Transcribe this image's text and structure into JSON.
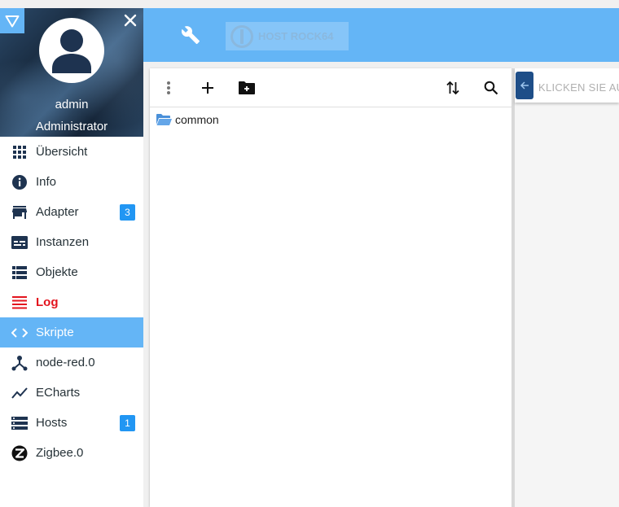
{
  "user": {
    "name": "admin",
    "role": "Administrator"
  },
  "sidebar": {
    "items": [
      {
        "label": "Übersicht",
        "icon": "grid-icon"
      },
      {
        "label": "Info",
        "icon": "info-icon"
      },
      {
        "label": "Adapter",
        "icon": "store-icon",
        "badge": "3"
      },
      {
        "label": "Instanzen",
        "icon": "instances-icon"
      },
      {
        "label": "Objekte",
        "icon": "list-icon"
      },
      {
        "label": "Log",
        "icon": "log-icon"
      },
      {
        "label": "Skripte",
        "icon": "code-icon",
        "active": true
      },
      {
        "label": "node-red.0",
        "icon": "node-red-icon"
      },
      {
        "label": "ECharts",
        "icon": "chart-line-icon"
      },
      {
        "label": "Hosts",
        "icon": "hosts-icon",
        "badge": "1"
      },
      {
        "label": "Zigbee.0",
        "icon": "zigbee-icon"
      }
    ]
  },
  "topbar": {
    "host_label": "HOST ROCK64"
  },
  "tree": {
    "items": [
      {
        "label": "common",
        "type": "folder"
      }
    ]
  },
  "right_panel": {
    "hint": "KLICKEN SIE AUF ..."
  },
  "colors": {
    "accent": "#64b5f6",
    "active_bg": "#64b5f6",
    "badge": "#2196f3",
    "log": "#e3141e",
    "icon_dark": "#1e3350"
  }
}
